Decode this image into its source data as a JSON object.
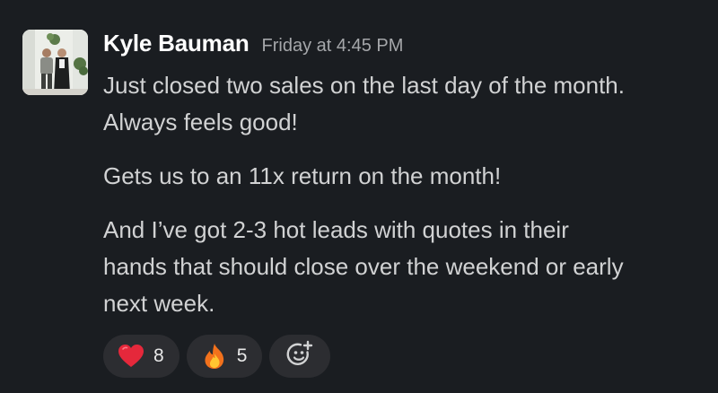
{
  "message": {
    "author": "Kyle Bauman",
    "timestamp": "Friday at 4:45 PM",
    "paragraphs": [
      [
        "Just closed two sales on the last day of the month.",
        "Always feels good!"
      ],
      [
        "Gets us to an 11x return on the month!"
      ],
      [
        "And I’ve got 2-3 hot leads with quotes in their",
        "hands that should close over the weekend or early",
        "next week."
      ]
    ]
  },
  "reactions": [
    {
      "icon": "heart-emoji-icon",
      "count": "8"
    },
    {
      "icon": "fire-emoji-icon",
      "count": "5"
    }
  ],
  "add_reaction_icon": "add-reaction-icon",
  "colors": {
    "background": "#1a1d21",
    "author": "#ffffff",
    "text": "#d1d2d3",
    "timestamp": "#a5a7aa",
    "reaction_pill": "#2c2d31"
  }
}
